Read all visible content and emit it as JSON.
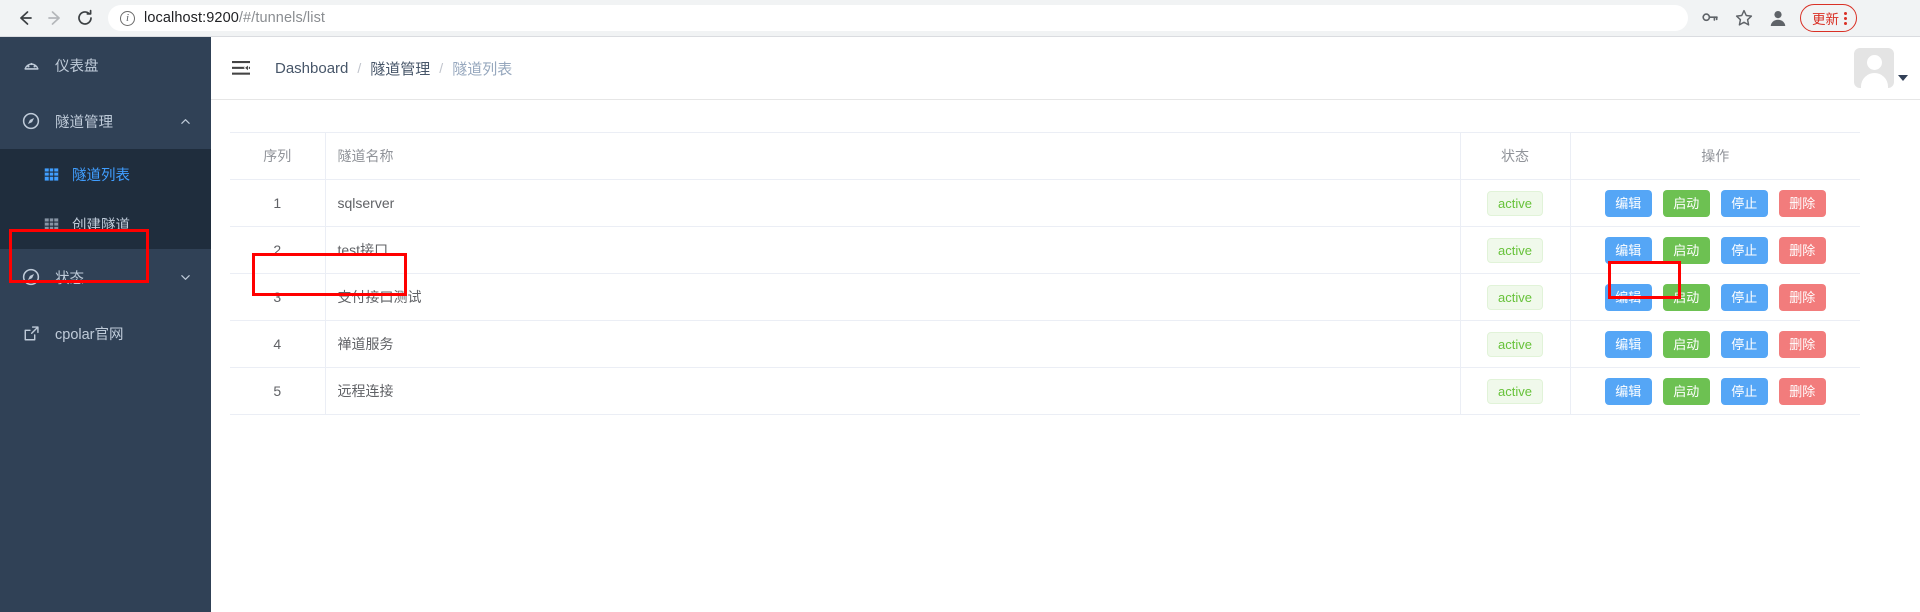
{
  "browser": {
    "back_icon": "back-arrow-icon",
    "forward_icon": "forward-arrow-icon",
    "reload_icon": "reload-icon",
    "url_host": "localhost:9200",
    "url_path": "/#/tunnels/list",
    "info_glyph": "i",
    "key_icon": "key-icon",
    "star_icon": "star-icon",
    "profile_icon": "profile-icon",
    "update_label": "更新",
    "menu_icon": "vertical-dots-icon"
  },
  "sidebar": {
    "items": [
      {
        "label": "仪表盘",
        "icon": "gauge-icon"
      },
      {
        "label": "隧道管理",
        "icon": "compass-icon",
        "chevron": "chevron-up-icon"
      },
      {
        "label": "状态",
        "icon": "compass-icon",
        "chevron": "chevron-down-icon"
      },
      {
        "label": "cpolar官网",
        "icon": "external-link-icon"
      }
    ],
    "submenu": [
      {
        "label": "隧道列表",
        "icon": "grid-icon",
        "active": true
      },
      {
        "label": "创建隧道",
        "icon": "grid-icon",
        "active": false
      }
    ]
  },
  "header": {
    "hamburger_icon": "sidebar-collapse-icon",
    "breadcrumb": [
      "Dashboard",
      "隧道管理",
      "隧道列表"
    ],
    "separator": "/",
    "avatar_icon": "avatar-placeholder-icon",
    "caret_icon": "caret-down-icon"
  },
  "table": {
    "columns": [
      "序列",
      "隧道名称",
      "状态",
      "操作"
    ],
    "rows": [
      {
        "seq": "1",
        "name": "sqlserver",
        "state": "active"
      },
      {
        "seq": "2",
        "name": "test接口",
        "state": "active"
      },
      {
        "seq": "3",
        "name": "支付接口测试",
        "state": "active"
      },
      {
        "seq": "4",
        "name": "禅道服务",
        "state": "active"
      },
      {
        "seq": "5",
        "name": "远程连接",
        "state": "active"
      }
    ],
    "actions": {
      "edit": "编辑",
      "start": "启动",
      "stop": "停止",
      "delete": "删除"
    }
  },
  "colors": {
    "sidebar_bg": "#304156",
    "submenu_bg": "#1f2d3d",
    "accent_blue": "#409eff",
    "button_primary": "#55a6f6",
    "button_success": "#6dc152",
    "button_danger": "#f27c7c",
    "tag_green_text": "#67c23a",
    "tag_green_bg": "#f0f9eb",
    "annotation_red": "#ff0000",
    "update_red": "#d93025"
  }
}
